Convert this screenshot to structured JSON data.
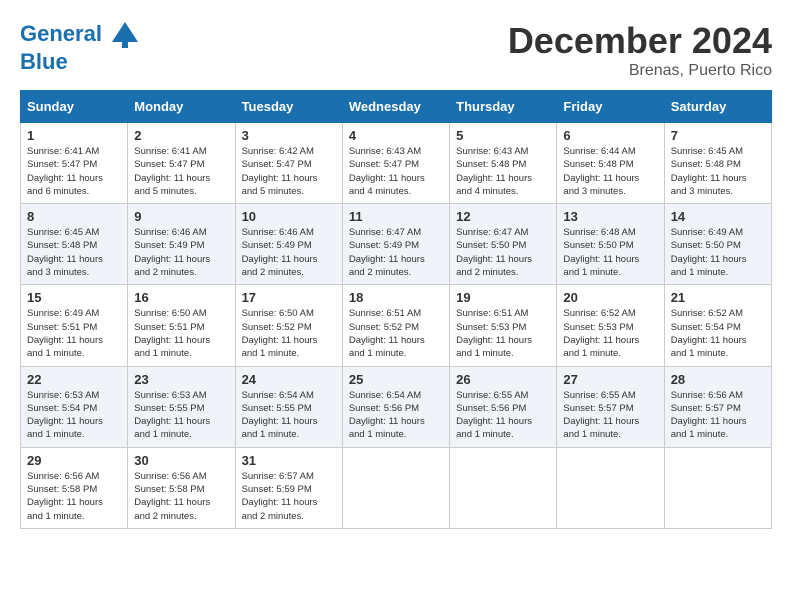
{
  "header": {
    "logo_line1": "General",
    "logo_line2": "Blue",
    "month_title": "December 2024",
    "location": "Brenas, Puerto Rico"
  },
  "days_of_week": [
    "Sunday",
    "Monday",
    "Tuesday",
    "Wednesday",
    "Thursday",
    "Friday",
    "Saturday"
  ],
  "weeks": [
    [
      {
        "day": "1",
        "sunrise": "6:41 AM",
        "sunset": "5:47 PM",
        "daylight": "11 hours and 6 minutes."
      },
      {
        "day": "2",
        "sunrise": "6:41 AM",
        "sunset": "5:47 PM",
        "daylight": "11 hours and 5 minutes."
      },
      {
        "day": "3",
        "sunrise": "6:42 AM",
        "sunset": "5:47 PM",
        "daylight": "11 hours and 5 minutes."
      },
      {
        "day": "4",
        "sunrise": "6:43 AM",
        "sunset": "5:47 PM",
        "daylight": "11 hours and 4 minutes."
      },
      {
        "day": "5",
        "sunrise": "6:43 AM",
        "sunset": "5:48 PM",
        "daylight": "11 hours and 4 minutes."
      },
      {
        "day": "6",
        "sunrise": "6:44 AM",
        "sunset": "5:48 PM",
        "daylight": "11 hours and 3 minutes."
      },
      {
        "day": "7",
        "sunrise": "6:45 AM",
        "sunset": "5:48 PM",
        "daylight": "11 hours and 3 minutes."
      }
    ],
    [
      {
        "day": "8",
        "sunrise": "6:45 AM",
        "sunset": "5:48 PM",
        "daylight": "11 hours and 3 minutes."
      },
      {
        "day": "9",
        "sunrise": "6:46 AM",
        "sunset": "5:49 PM",
        "daylight": "11 hours and 2 minutes."
      },
      {
        "day": "10",
        "sunrise": "6:46 AM",
        "sunset": "5:49 PM",
        "daylight": "11 hours and 2 minutes."
      },
      {
        "day": "11",
        "sunrise": "6:47 AM",
        "sunset": "5:49 PM",
        "daylight": "11 hours and 2 minutes."
      },
      {
        "day": "12",
        "sunrise": "6:47 AM",
        "sunset": "5:50 PM",
        "daylight": "11 hours and 2 minutes."
      },
      {
        "day": "13",
        "sunrise": "6:48 AM",
        "sunset": "5:50 PM",
        "daylight": "11 hours and 1 minute."
      },
      {
        "day": "14",
        "sunrise": "6:49 AM",
        "sunset": "5:50 PM",
        "daylight": "11 hours and 1 minute."
      }
    ],
    [
      {
        "day": "15",
        "sunrise": "6:49 AM",
        "sunset": "5:51 PM",
        "daylight": "11 hours and 1 minute."
      },
      {
        "day": "16",
        "sunrise": "6:50 AM",
        "sunset": "5:51 PM",
        "daylight": "11 hours and 1 minute."
      },
      {
        "day": "17",
        "sunrise": "6:50 AM",
        "sunset": "5:52 PM",
        "daylight": "11 hours and 1 minute."
      },
      {
        "day": "18",
        "sunrise": "6:51 AM",
        "sunset": "5:52 PM",
        "daylight": "11 hours and 1 minute."
      },
      {
        "day": "19",
        "sunrise": "6:51 AM",
        "sunset": "5:53 PM",
        "daylight": "11 hours and 1 minute."
      },
      {
        "day": "20",
        "sunrise": "6:52 AM",
        "sunset": "5:53 PM",
        "daylight": "11 hours and 1 minute."
      },
      {
        "day": "21",
        "sunrise": "6:52 AM",
        "sunset": "5:54 PM",
        "daylight": "11 hours and 1 minute."
      }
    ],
    [
      {
        "day": "22",
        "sunrise": "6:53 AM",
        "sunset": "5:54 PM",
        "daylight": "11 hours and 1 minute."
      },
      {
        "day": "23",
        "sunrise": "6:53 AM",
        "sunset": "5:55 PM",
        "daylight": "11 hours and 1 minute."
      },
      {
        "day": "24",
        "sunrise": "6:54 AM",
        "sunset": "5:55 PM",
        "daylight": "11 hours and 1 minute."
      },
      {
        "day": "25",
        "sunrise": "6:54 AM",
        "sunset": "5:56 PM",
        "daylight": "11 hours and 1 minute."
      },
      {
        "day": "26",
        "sunrise": "6:55 AM",
        "sunset": "5:56 PM",
        "daylight": "11 hours and 1 minute."
      },
      {
        "day": "27",
        "sunrise": "6:55 AM",
        "sunset": "5:57 PM",
        "daylight": "11 hours and 1 minute."
      },
      {
        "day": "28",
        "sunrise": "6:56 AM",
        "sunset": "5:57 PM",
        "daylight": "11 hours and 1 minute."
      }
    ],
    [
      {
        "day": "29",
        "sunrise": "6:56 AM",
        "sunset": "5:58 PM",
        "daylight": "11 hours and 1 minute."
      },
      {
        "day": "30",
        "sunrise": "6:56 AM",
        "sunset": "5:58 PM",
        "daylight": "11 hours and 2 minutes."
      },
      {
        "day": "31",
        "sunrise": "6:57 AM",
        "sunset": "5:59 PM",
        "daylight": "11 hours and 2 minutes."
      },
      null,
      null,
      null,
      null
    ]
  ],
  "labels": {
    "sunrise": "Sunrise:",
    "sunset": "Sunset:",
    "daylight": "Daylight:"
  }
}
